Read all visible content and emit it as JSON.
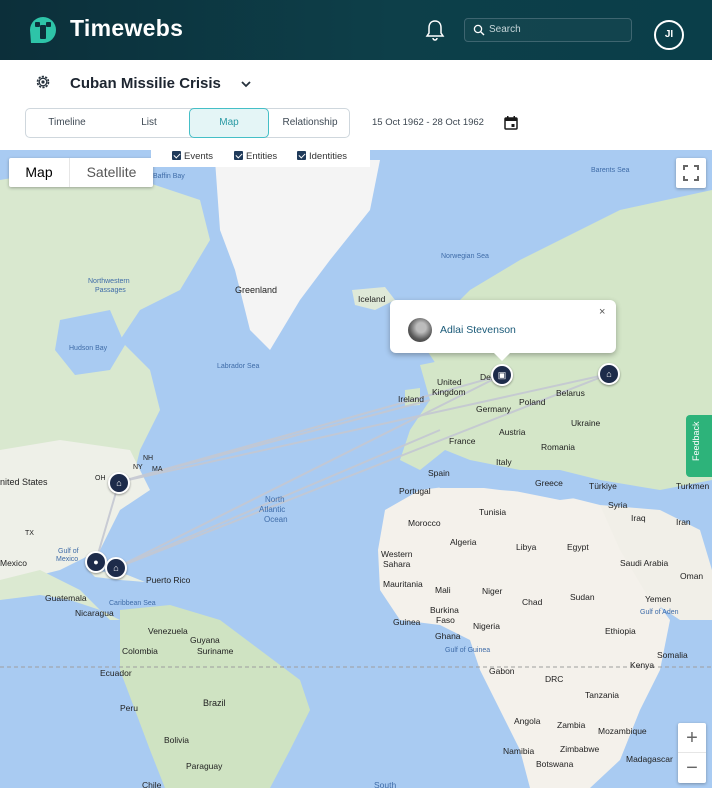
{
  "header": {
    "brand": "Timewebs",
    "search_placeholder": "Search",
    "user_initials": "JI",
    "icons": [
      "logo-icon",
      "bell-icon",
      "search-icon"
    ]
  },
  "project": {
    "title": "Cuban Missilie Crisis",
    "tabs": [
      {
        "label": "Timeline",
        "active": false
      },
      {
        "label": "List",
        "active": false
      },
      {
        "label": "Map",
        "active": true
      },
      {
        "label": "Relationship",
        "active": false
      }
    ],
    "date_range": "15 Oct 1962 - 28 Oct 1962"
  },
  "map": {
    "type_buttons": {
      "map": "Map",
      "satellite": "Satellite"
    },
    "filters": [
      {
        "label": "Events",
        "checked": true
      },
      {
        "label": "Entities",
        "checked": true
      },
      {
        "label": "Identities",
        "checked": true
      }
    ],
    "popup": {
      "name": "Adlai Stevenson",
      "close": "×"
    },
    "feedback": "Feedback",
    "zoom": {
      "in": "+",
      "out": "−"
    },
    "labels": [
      {
        "key": "Greenland",
        "text": "Greenland"
      },
      {
        "key": "Iceland",
        "text": "Iceland"
      },
      {
        "key": "Hudson",
        "text": "Hudson Bay"
      },
      {
        "key": "NWP",
        "text": "Northwestern"
      },
      {
        "key": "NWP2",
        "text": "Passages"
      },
      {
        "key": "Labrador",
        "text": "Labrador Sea"
      },
      {
        "key": "Norwegian",
        "text": "Norwegian Sea"
      },
      {
        "key": "Barents",
        "text": "Barents Sea"
      },
      {
        "key": "Baffin",
        "text": "Baffin Bay"
      },
      {
        "key": "US",
        "text": "nited States"
      },
      {
        "key": "Mexico",
        "text": "Mexico"
      },
      {
        "key": "Gulf",
        "text": "Gulf of"
      },
      {
        "key": "Gulf2",
        "text": "Mexico"
      },
      {
        "key": "Guatemala",
        "text": "Guatemala"
      },
      {
        "key": "Nicaragua",
        "text": "Nicaragua"
      },
      {
        "key": "Caribbean",
        "text": "Caribbean Sea"
      },
      {
        "key": "PuertoRico",
        "text": "Puerto Rico"
      },
      {
        "key": "Venezuela",
        "text": "Venezuela"
      },
      {
        "key": "Guyana",
        "text": "Guyana"
      },
      {
        "key": "Suriname",
        "text": "Suriname"
      },
      {
        "key": "Colombia",
        "text": "Colombia"
      },
      {
        "key": "Ecuador",
        "text": "Ecuador"
      },
      {
        "key": "Peru",
        "text": "Peru"
      },
      {
        "key": "Brazil",
        "text": "Brazil"
      },
      {
        "key": "Bolivia",
        "text": "Bolivia"
      },
      {
        "key": "Paraguay",
        "text": "Paraguay"
      },
      {
        "key": "Chile",
        "text": "Chile"
      },
      {
        "key": "NAO",
        "text": "North"
      },
      {
        "key": "NAO2",
        "text": "Atlantic"
      },
      {
        "key": "NAO3",
        "text": "Ocean"
      },
      {
        "key": "Ireland",
        "text": "Ireland"
      },
      {
        "key": "UK",
        "text": "United"
      },
      {
        "key": "UK2",
        "text": "Kingdom"
      },
      {
        "key": "Germany",
        "text": "Germany"
      },
      {
        "key": "Poland",
        "text": "Poland"
      },
      {
        "key": "Belarus",
        "text": "Belarus"
      },
      {
        "key": "Ukraine",
        "text": "Ukraine"
      },
      {
        "key": "Austria",
        "text": "Austria"
      },
      {
        "key": "France",
        "text": "France"
      },
      {
        "key": "Romania",
        "text": "Romania"
      },
      {
        "key": "Italy",
        "text": "Italy"
      },
      {
        "key": "Spain",
        "text": "Spain"
      },
      {
        "key": "Portugal",
        "text": "Portugal"
      },
      {
        "key": "Greece",
        "text": "Greece"
      },
      {
        "key": "Turkey",
        "text": "Türkiye"
      },
      {
        "key": "Turkmen",
        "text": "Turkmen"
      },
      {
        "key": "Syria",
        "text": "Syria"
      },
      {
        "key": "Iraq",
        "text": "Iraq"
      },
      {
        "key": "Iran",
        "text": "Iran"
      },
      {
        "key": "Tunisia",
        "text": "Tunisia"
      },
      {
        "key": "Morocco",
        "text": "Morocco"
      },
      {
        "key": "Algeria",
        "text": "Algeria"
      },
      {
        "key": "Libya",
        "text": "Libya"
      },
      {
        "key": "Egypt",
        "text": "Egypt"
      },
      {
        "key": "WSahara",
        "text": "Western"
      },
      {
        "key": "WSahara2",
        "text": "Sahara"
      },
      {
        "key": "Mauritania",
        "text": "Mauritania"
      },
      {
        "key": "Mali",
        "text": "Mali"
      },
      {
        "key": "Niger",
        "text": "Niger"
      },
      {
        "key": "Chad",
        "text": "Chad"
      },
      {
        "key": "Sudan",
        "text": "Sudan"
      },
      {
        "key": "SaudiArabia",
        "text": "Saudi Arabia"
      },
      {
        "key": "Oman",
        "text": "Oman"
      },
      {
        "key": "Yemen",
        "text": "Yemen"
      },
      {
        "key": "GulfAden",
        "text": "Gulf of Aden"
      },
      {
        "key": "Ethiopia",
        "text": "Ethiopia"
      },
      {
        "key": "Somalia",
        "text": "Somalia"
      },
      {
        "key": "Guinea",
        "text": "Guinea"
      },
      {
        "key": "Burkina",
        "text": "Burkina"
      },
      {
        "key": "Faso",
        "text": "Faso"
      },
      {
        "key": "Ghana",
        "text": "Ghana"
      },
      {
        "key": "Nigeria",
        "text": "Nigeria"
      },
      {
        "key": "GulfGuinea",
        "text": "Gulf of Guinea"
      },
      {
        "key": "Gabon",
        "text": "Gabon"
      },
      {
        "key": "DRC",
        "text": "DRC"
      },
      {
        "key": "Kenya",
        "text": "Kenya"
      },
      {
        "key": "Tanzania",
        "text": "Tanzania"
      },
      {
        "key": "Angola",
        "text": "Angola"
      },
      {
        "key": "Zambia",
        "text": "Zambia"
      },
      {
        "key": "Namibia",
        "text": "Namibia"
      },
      {
        "key": "Zimbabwe",
        "text": "Zimbabwe"
      },
      {
        "key": "Botswana",
        "text": "Botswana"
      },
      {
        "key": "Mozambique",
        "text": "Mozambique"
      },
      {
        "key": "Madagascar",
        "text": "Madagascar"
      },
      {
        "key": "South",
        "text": "South"
      },
      {
        "key": "Del",
        "text": "Det"
      },
      {
        "key": "NH",
        "text": "NH"
      },
      {
        "key": "NY",
        "text": "NY"
      },
      {
        "key": "MA",
        "text": "MA"
      },
      {
        "key": "OH",
        "text": "OH"
      },
      {
        "key": "TX",
        "text": "TX"
      }
    ]
  },
  "colors": {
    "header_bg": "#0c2f3a",
    "accent": "#45bfc7",
    "water": "#a9cbf2",
    "land": "#f3f1ec",
    "marker": "#1d2b4a",
    "feedback": "#2db37a"
  }
}
